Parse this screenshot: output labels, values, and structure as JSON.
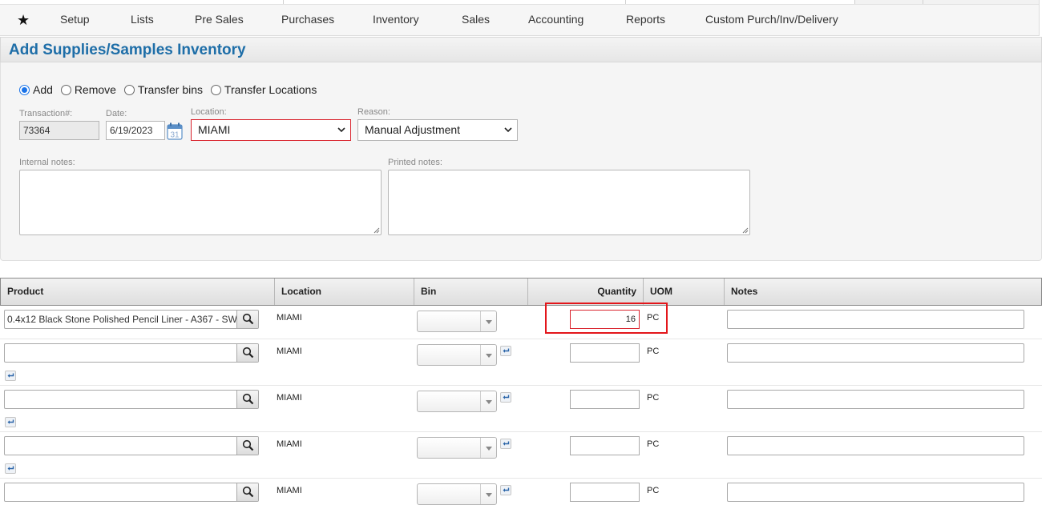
{
  "nav": {
    "star_icon": "star-icon",
    "items": [
      "Setup",
      "Lists",
      "Pre Sales",
      "Purchases",
      "Inventory",
      "Sales",
      "Accounting",
      "Reports",
      "Custom Purch/Inv/Delivery"
    ]
  },
  "page": {
    "title": "Add Supplies/Samples Inventory"
  },
  "mode": {
    "options": [
      "Add",
      "Remove",
      "Transfer bins",
      "Transfer Locations"
    ],
    "selected": "Add"
  },
  "fields": {
    "transaction_label": "Transaction#:",
    "transaction_value": "73364",
    "date_label": "Date:",
    "date_value": "6/19/2023",
    "calendar_icon": "calendar-icon",
    "calendar_day": "31",
    "location_label": "Location:",
    "location_value": "MIAMI",
    "reason_label": "Reason:",
    "reason_value": "Manual Adjustment",
    "internal_notes_label": "Internal notes:",
    "printed_notes_label": "Printed notes:"
  },
  "grid": {
    "columns": [
      "Product",
      "Location",
      "Bin",
      "Quantity",
      "UOM",
      "Notes"
    ],
    "rows": [
      {
        "product": "0.4x12 Black Stone Polished Pencil Liner - A367 - SW",
        "location": "MIAMI",
        "bin": "",
        "quantity": "16",
        "uom": "PC",
        "notes": ""
      },
      {
        "product": "",
        "location": "MIAMI",
        "bin": "",
        "quantity": "",
        "uom": "PC",
        "notes": ""
      },
      {
        "product": "",
        "location": "MIAMI",
        "bin": "",
        "quantity": "",
        "uom": "PC",
        "notes": ""
      },
      {
        "product": "",
        "location": "MIAMI",
        "bin": "",
        "quantity": "",
        "uom": "PC",
        "notes": ""
      },
      {
        "product": "",
        "location": "MIAMI",
        "bin": "",
        "quantity": "",
        "uom": "PC",
        "notes": ""
      }
    ]
  },
  "colors": {
    "title": "#1e6ea8",
    "highlight": "#e3161b",
    "error_border": "#d9232d",
    "radio_accent": "#1a73e8"
  }
}
